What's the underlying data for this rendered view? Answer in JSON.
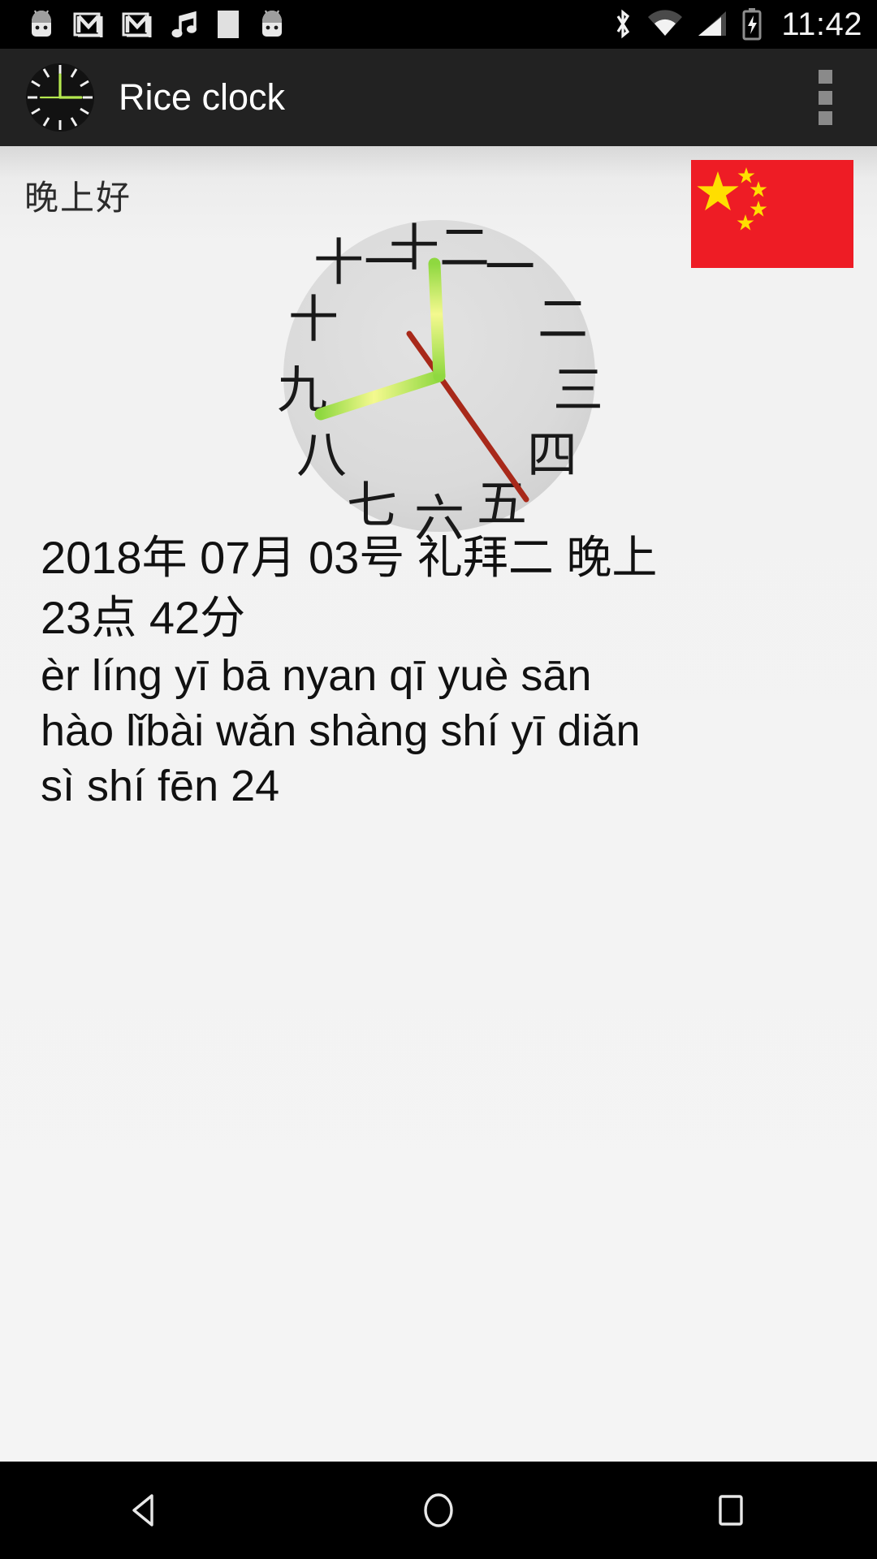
{
  "status_bar": {
    "time": "11:42",
    "left_icons": [
      {
        "name": "android-mascot-icon"
      },
      {
        "name": "gmail-icon"
      },
      {
        "name": "gmail-icon"
      },
      {
        "name": "music-note-icon"
      },
      {
        "name": "blank-square-icon"
      },
      {
        "name": "android-mascot-icon"
      }
    ],
    "right_icons": [
      {
        "name": "bluetooth-icon"
      },
      {
        "name": "wifi-icon"
      },
      {
        "name": "cellular-signal-icon"
      },
      {
        "name": "battery-charging-icon"
      }
    ]
  },
  "app_bar": {
    "title": "Rice clock",
    "icon": "clock-app-icon",
    "overflow": "overflow-menu-icon"
  },
  "main": {
    "greeting": "晚上好",
    "flag": {
      "name": "china-flag",
      "red": "#ee1c25",
      "star": "#ffde00"
    },
    "clock": {
      "name": "analog-clock",
      "face_color": "#d9d9d9",
      "hour_hand_color": "#a8e84a",
      "minute_hand_color": "#e8f25a",
      "second_hand_color": "#b02a18",
      "numerals": [
        "一",
        "二",
        "三",
        "四",
        "五",
        "六",
        "七",
        "八",
        "九",
        "十",
        "十一",
        "十二"
      ],
      "hour_value": 11,
      "minute_value": 42,
      "second_value": 24
    },
    "date_lines": [
      "2018年 07月 03号 礼拜二 晚上",
      "23点 42分"
    ],
    "pinyin_lines": [
      "èr líng yī bā nyan qī yuè sān",
      "hào lǐbài wǎn shàng shí yī diǎn",
      "sì shí fēn 24"
    ]
  },
  "nav_bar": {
    "back": "back-triangle-icon",
    "home": "home-circle-icon",
    "recents": "recents-square-icon"
  }
}
